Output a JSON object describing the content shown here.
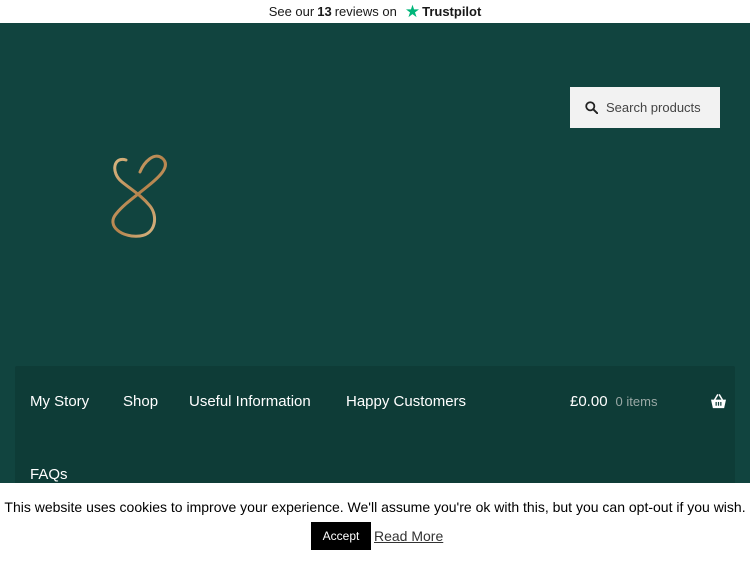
{
  "trustbar": {
    "prefix": "See our",
    "count": "13",
    "suffix": "reviews on",
    "brand": "Trustpilot"
  },
  "search": {
    "placeholder": "Search products"
  },
  "nav": {
    "items": [
      {
        "label": "My Story"
      },
      {
        "label": "Shop"
      },
      {
        "label": "Useful Information"
      },
      {
        "label": "Happy Customers"
      },
      {
        "label": "FAQs"
      }
    ]
  },
  "cart": {
    "amount": "£0.00",
    "items": "0 items"
  },
  "cookie": {
    "message": "This website uses cookies to improve your experience. We'll assume you're ok with this, but you can opt-out if you wish.",
    "accept_label": "Accept",
    "read_more_label": "Read More"
  },
  "colors": {
    "background": "#11443f",
    "nav_background": "#0e3c37",
    "trustpilot_green": "#00b67a",
    "logo_gold": "#c59a64"
  },
  "icons": {
    "search": "search-icon",
    "star": "trustpilot-star-icon",
    "cart": "basket-icon",
    "logo": "heart-infinity-logo"
  }
}
